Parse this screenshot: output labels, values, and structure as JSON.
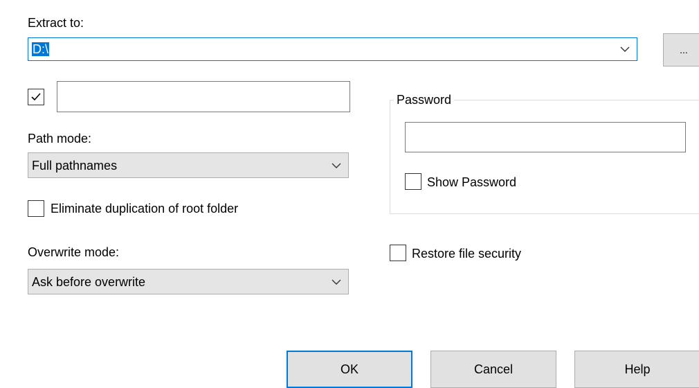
{
  "extract": {
    "label": "Extract to:",
    "value": "D:\\",
    "browse_label": "..."
  },
  "destination_checkbox": {
    "checked": true,
    "value": ""
  },
  "path_mode": {
    "label": "Path mode:",
    "selected": "Full pathnames"
  },
  "eliminate_root": {
    "label": "Eliminate duplication of root folder",
    "checked": false
  },
  "overwrite_mode": {
    "label": "Overwrite mode:",
    "selected": "Ask before overwrite"
  },
  "password": {
    "group_label": "Password",
    "value": "",
    "show_label": "Show Password",
    "show_checked": false
  },
  "restore_security": {
    "label": "Restore file security",
    "checked": false
  },
  "buttons": {
    "ok": "OK",
    "cancel": "Cancel",
    "help": "Help"
  },
  "colors": {
    "accent": "#0078d7",
    "button_face": "#e1e1e1",
    "disabled_face": "#e5e5e5"
  },
  "icons": {
    "dropdown": "chevron-down-icon",
    "check": "checkmark-icon"
  }
}
